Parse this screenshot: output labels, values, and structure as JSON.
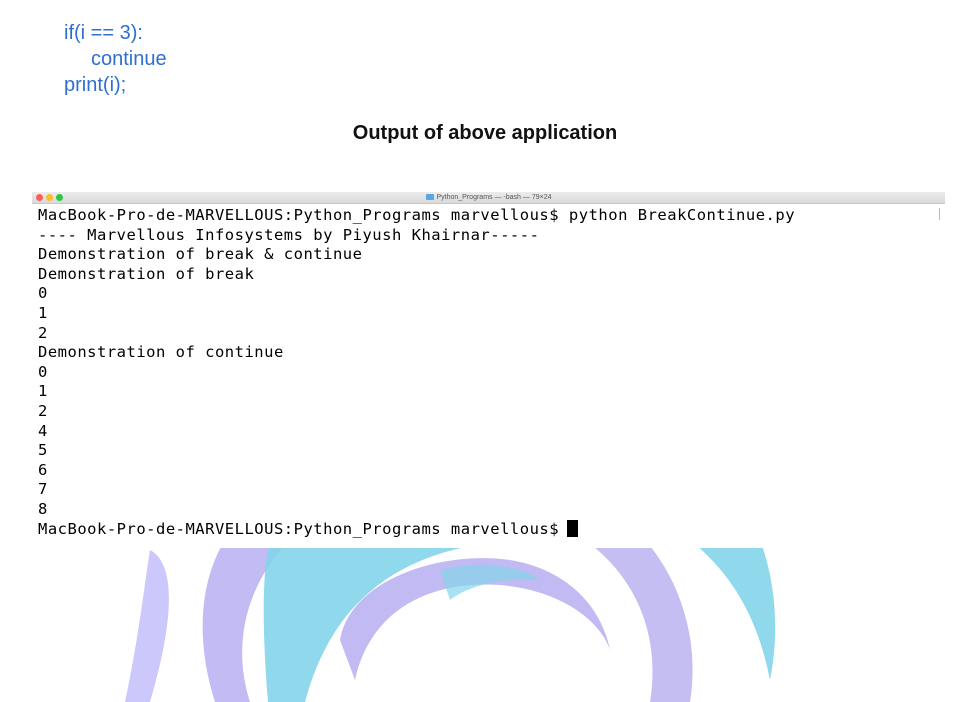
{
  "code_snippet": {
    "lines": [
      "if(i == 3):",
      "continue",
      "print(i);"
    ]
  },
  "heading": "Output of above application",
  "terminal": {
    "window_title": "Python_Programs — -bash — 79×24",
    "lines": [
      "MacBook-Pro-de-MARVELLOUS:Python_Programs marvellous$ python BreakContinue.py",
      "---- Marvellous Infosystems by Piyush Khairnar-----",
      "Demonstration of break & continue",
      "Demonstration of break",
      "0",
      "1",
      "2",
      "Demonstration of continue",
      "0",
      "1",
      "2",
      "4",
      "5",
      "6",
      "7",
      "8",
      "MacBook-Pro-de-MARVELLOUS:Python_Programs marvellous$"
    ]
  },
  "colors": {
    "code_text": "#2f6fd1",
    "watermark_purple": "#b9b2ef",
    "watermark_cyan": "#8fd8ec"
  }
}
